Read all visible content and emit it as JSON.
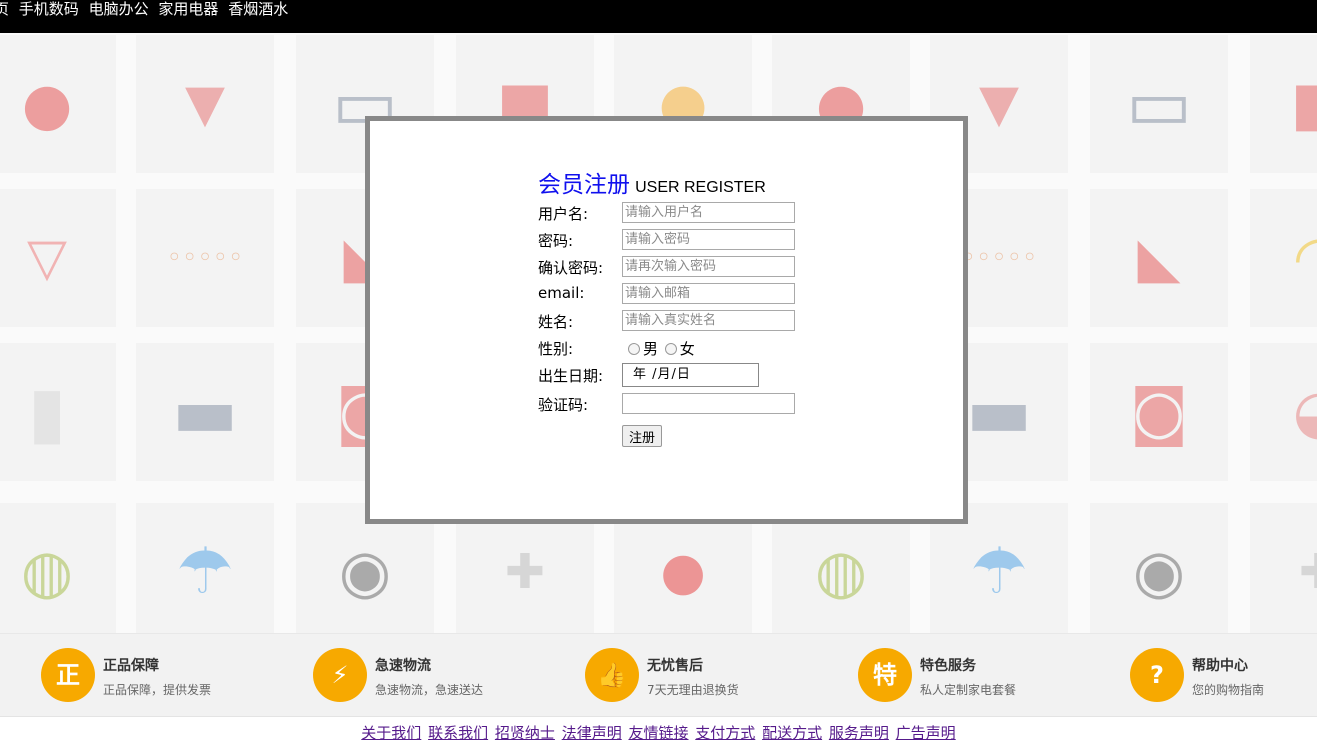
{
  "nav": {
    "items": [
      "页",
      "手机数码",
      "电脑办公",
      "家用电器",
      "香烟酒水"
    ]
  },
  "background": {
    "tile_icons": [
      "apple-icon",
      "popcorn-icon",
      "monitor-icon",
      "gift-icon",
      "orange-icon",
      "apple-icon",
      "popcorn-icon",
      "monitor-icon",
      "gift-icon",
      "cocktail-icon",
      "eggs-icon",
      "sneaker-icon",
      "gift-icon",
      "orange-icon",
      "apple-icon",
      "eggs-icon",
      "sneaker-icon",
      "banana-icon",
      "milk-bottle-icon",
      "laptop-icon",
      "ipod-icon",
      "gift-icon",
      "orange-icon",
      "apple-icon",
      "laptop-icon",
      "ipod-icon",
      "beach-ball-icon",
      "kiwi-icon",
      "umbrella-icon",
      "camera-icon",
      "gamepad-icon",
      "cherry-icon",
      "kiwi-icon",
      "umbrella-icon",
      "camera-icon",
      "gamepad-icon"
    ]
  },
  "register": {
    "title_cn": "会员注册",
    "title_en": "USER REGISTER",
    "username_label": "用户名:",
    "username_placeholder": "请输入用户名",
    "password_label": "密码:",
    "password_placeholder": "请输入密码",
    "confirm_label": "确认密码:",
    "confirm_placeholder": "请再次输入密码",
    "email_label": "email:",
    "email_placeholder": "请输入邮箱",
    "name_label": "姓名:",
    "name_placeholder": "请输入真实姓名",
    "gender_label": "性别:",
    "gender_male": "男",
    "gender_female": "女",
    "birthday_label": "出生日期:",
    "birthday_value": "年 /月/日",
    "captcha_label": "验证码:",
    "captcha_value": "",
    "submit_label": "注册"
  },
  "features": [
    {
      "icon": "shield-icon",
      "glyph": "正",
      "title": "正品保障",
      "desc": "正品保障，提供发票"
    },
    {
      "icon": "delivery-icon",
      "glyph": "⚡",
      "title": "急速物流",
      "desc": "急速物流，急速送达"
    },
    {
      "icon": "thumbs-up-icon",
      "glyph": "👍",
      "title": "无忧售后",
      "desc": "7天无理由退换货"
    },
    {
      "icon": "special-icon",
      "glyph": "特",
      "title": "特色服务",
      "desc": "私人定制家电套餐"
    },
    {
      "icon": "help-icon",
      "glyph": "?",
      "title": "帮助中心",
      "desc": "您的购物指南"
    }
  ],
  "footer": {
    "links": [
      "关于我们",
      "联系我们",
      "招贤纳士",
      "法律声明",
      "友情链接",
      "支付方式",
      "配送方式",
      "服务声明",
      "广告声明"
    ]
  },
  "colors": {
    "nav_bg": "#000000",
    "title_blue": "#1010ee",
    "feature_orange": "#f7a900",
    "link_purple": "#551a8b",
    "modal_border": "#888888"
  }
}
